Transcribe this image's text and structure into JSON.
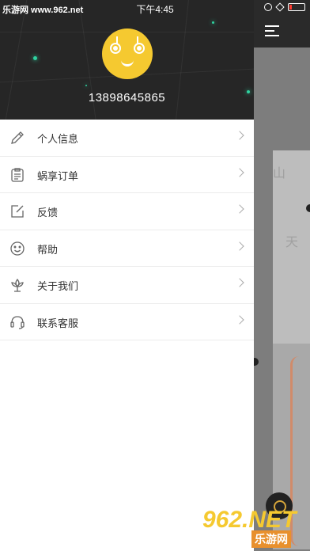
{
  "status_bar": {
    "watermark": "乐游网 www.962.net",
    "time": "下午4:45"
  },
  "profile": {
    "phone": "13898645865"
  },
  "menu": {
    "items": [
      {
        "label": "个人信息",
        "icon": "pencil-icon"
      },
      {
        "label": "蜗享订单",
        "icon": "clipboard-icon"
      },
      {
        "label": "反馈",
        "icon": "edit-square-icon"
      },
      {
        "label": "帮助",
        "icon": "smile-icon"
      },
      {
        "label": "关于我们",
        "icon": "lotus-icon"
      },
      {
        "label": "联系客服",
        "icon": "headset-icon"
      }
    ]
  },
  "map": {
    "label_top": "山",
    "label_mid": "天"
  },
  "logo": {
    "main": "962.NET",
    "sub": "乐游网"
  }
}
